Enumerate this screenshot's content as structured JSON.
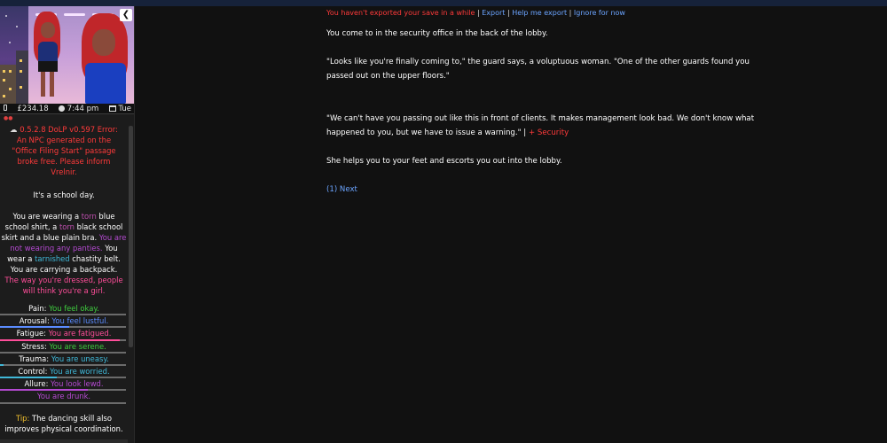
{
  "sidebar": {
    "stats": {
      "money": "£234.18",
      "time": "7:44 pm",
      "day": "Tue"
    },
    "portrait_close": "❮",
    "error_text": "0.5.2.8 DoLP v0.597 Error: An NPC generated on the \"Office Filing Start\" passage broke free. Please inform Vrelnir.",
    "school_day": "It's a school day.",
    "clothing": {
      "p1": "You are wearing a ",
      "torn1": "torn",
      "p2": " blue school shirt, a ",
      "torn2": "torn",
      "p3": " black school skirt and a blue plain bra. ",
      "no_panties": "You are not wearing any panties.",
      "p4": " You wear a ",
      "tarnished": "tarnished",
      "p5": " chastity belt. You are carrying a backpack."
    },
    "dressed_warning": "The way you're dressed, people will think you're a girl.",
    "meters": [
      {
        "label": "Pain",
        "status": "You feel okay.",
        "color": "#3fcf3f",
        "fill": 0.0
      },
      {
        "label": "Arousal",
        "status": "You feel lustful.",
        "color": "#5b8cff",
        "fill": 0.55
      },
      {
        "label": "Fatigue",
        "status": "You are fatigued.",
        "color": "#ff4e9a",
        "fill": 0.95
      },
      {
        "label": "Stress",
        "status": "You are serene.",
        "color": "#3fcf3f",
        "fill": 0.0
      },
      {
        "label": "Trauma",
        "status": "You are uneasy.",
        "color": "#40b8d8",
        "fill": 0.03
      },
      {
        "label": "Control",
        "status": "You are worried.",
        "color": "#40b8d8",
        "fill": 0.45
      },
      {
        "label": "Allure",
        "status": "You look lewd.",
        "color": "#b54ad2",
        "fill": 0.7
      },
      {
        "label": "",
        "status": "You are drunk.",
        "color": "#b54ad2",
        "fill": 0.0
      }
    ],
    "tip_label": "Tip:",
    "tip_text": " The dancing skill also improves physical coordination."
  },
  "main": {
    "banner": {
      "warning": "You haven't exported your save in a while",
      "sep": " | ",
      "export": "Export",
      "help": "Help me export",
      "ignore": "Ignore for now"
    },
    "p1": "You come to in the security office in the back of the lobby.",
    "p2": "\"Looks like you're finally coming to,\" the guard says, a voluptuous woman. \"One of the other guards found you passed out on the upper floors.\"",
    "p3": "\"We can't have you passing out like this in front of clients. It makes management look bad. We don't know what happened to you, but we have to issue a warning.\" | ",
    "security": "+ Security",
    "p4": "She helps you to your feet and escorts you out into the lobby.",
    "next": "(1) Next"
  },
  "colors": {
    "background": "#111111",
    "sidebar": "#1c1c1c",
    "link": "#6ba4ff",
    "warning": "#ff3a3a"
  }
}
